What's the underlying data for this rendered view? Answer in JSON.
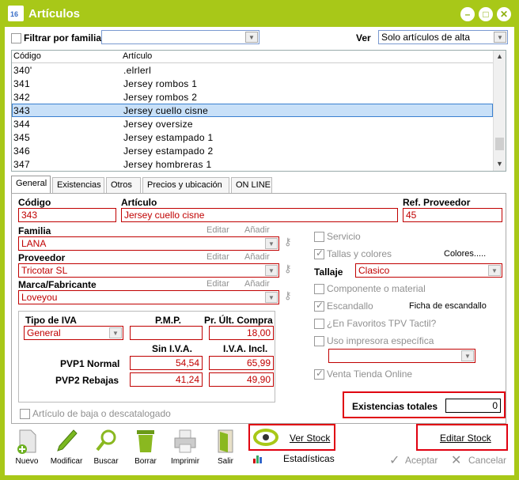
{
  "window": {
    "title": "Artículos",
    "icon": "calendar-icon",
    "accent": "#a8c818"
  },
  "filter": {
    "checkbox_label": "Filtrar por familia",
    "ver_label": "Ver",
    "ver_value": "Solo artículos de alta"
  },
  "list": {
    "col_codigo": "Código",
    "col_articulo": "Artículo",
    "rows": [
      {
        "codigo": "340'",
        "articulo": ".elrlerl"
      },
      {
        "codigo": "341",
        "articulo": "Jersey rombos 1"
      },
      {
        "codigo": "342",
        "articulo": "Jersey rombos 2"
      },
      {
        "codigo": "343",
        "articulo": "Jersey cuello cisne"
      },
      {
        "codigo": "344",
        "articulo": "Jersey oversize"
      },
      {
        "codigo": "345",
        "articulo": "Jersey estampado 1"
      },
      {
        "codigo": "346",
        "articulo": "Jersey estampado 2"
      },
      {
        "codigo": "347",
        "articulo": "Jersey hombreras 1"
      }
    ]
  },
  "tabs": [
    "General",
    "Existencias",
    "Otros",
    "Precios y ubicación",
    "ON LINE"
  ],
  "form": {
    "codigo_label": "Código",
    "codigo_value": "343",
    "articulo_label": "Artículo",
    "articulo_value": "Jersey cuello cisne",
    "ref_label": "Ref. Proveedor",
    "ref_value": "45",
    "familia_label": "Familia",
    "familia_value": "LANA",
    "proveedor_label": "Proveedor",
    "proveedor_value": "Tricotar SL",
    "marca_label": "Marca/Fabricante",
    "marca_value": "Loveyou",
    "editar": "Editar",
    "anadir": "Añadir",
    "tipo_iva_label": "Tipo de IVA",
    "tipo_iva_value": "General",
    "pmp_label": "P.M.P.",
    "pmp_value": "",
    "ult_compra_label": "Pr. Últ. Compra",
    "ult_compra_value": "18,00",
    "sin_iva_label": "Sin I.V.A.",
    "iva_incl_label": "I.V.A. Incl.",
    "pvp1_label": "PVP1 Normal",
    "pvp1_sin": "54,54",
    "pvp1_con": "65,99",
    "pvp2_label": "PVP2 Rebajas",
    "pvp2_sin": "41,24",
    "pvp2_con": "49,90",
    "baja_label": "Artículo de baja o descatalogado",
    "servicio_label": "Servicio",
    "tallas_label": "Tallas y colores",
    "colores_label": "Colores.....",
    "tallaje_label": "Tallaje",
    "tallaje_value": "Clasico",
    "componente_label": "Componente o material",
    "escandallo_label": "Escandallo",
    "ficha_label": "Ficha de escandallo",
    "favoritos_label": "¿En Favoritos TPV Tactil?",
    "impresora_label": "Uso impresora específica",
    "venta_online_label": "Venta Tienda Online",
    "existencias_label": "Existencias totales",
    "existencias_value": "0"
  },
  "toolbar": {
    "nuevo": "Nuevo",
    "modificar": "Modificar",
    "buscar": "Buscar",
    "borrar": "Borrar",
    "imprimir": "Imprimir",
    "salir": "Salir",
    "ver_stock": "Ver Stock",
    "estadisticas": "Estadísticas",
    "editar_stock": "Editar Stock",
    "aceptar": "Aceptar",
    "cancelar": "Cancelar"
  }
}
